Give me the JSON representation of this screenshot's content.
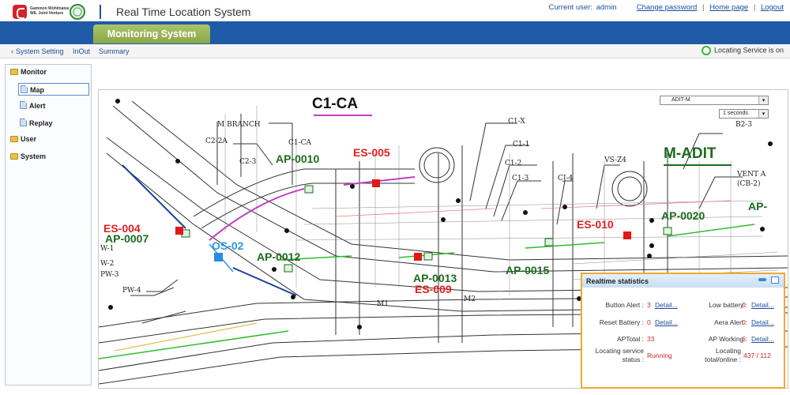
{
  "header": {
    "logo_text": "Gammon Wohlmatee WIL Joint Venture",
    "app_title": "Real Time Location System",
    "current_user_label": "Current user:",
    "current_user": "admin",
    "change_password": "Change password",
    "home_page": "Home page",
    "logout": "Logout",
    "separator": "|"
  },
  "tabs": {
    "active": "Monitoring System"
  },
  "subnav": {
    "back_icon": "chevron-left-icon",
    "items": [
      "System Setting",
      "InOut",
      "Summary"
    ],
    "status_text": "Locating Service is on",
    "status_color": "#2ebd2e"
  },
  "sidebar": {
    "items": [
      {
        "label": "Monitor",
        "icon": "folder-icon"
      },
      {
        "label": "Map",
        "icon": "document-icon",
        "selected": true
      },
      {
        "label": "Alert",
        "icon": "document-icon"
      },
      {
        "label": "Replay",
        "icon": "document-icon"
      },
      {
        "label": "User",
        "icon": "folder-icon"
      },
      {
        "label": "System",
        "icon": "folder-icon"
      }
    ]
  },
  "map": {
    "map_select": "ADIT-M",
    "interval_select": "1 seconds",
    "zone_titles": [
      "C1-CA",
      "M-ADIT"
    ],
    "labels": {
      "ap0010": "AP-0010",
      "ap0007": "AP-0007",
      "ap0012": "AP-0012",
      "ap0013": "AP-0013",
      "ap0015": "AP-0015",
      "ap0020": "AP-0020",
      "ap_partial": "AP-",
      "es005": "ES-005",
      "es004": "ES-004",
      "es009": "ES-009",
      "es010": "ES-010",
      "os02": "OS-02"
    },
    "drawing_labels": {
      "m_branch": "M BRANCH",
      "c2_2a": "C2-2A",
      "c2_3": "C2-3",
      "c1_ca": "C1-CA",
      "c1_x": "C1-X",
      "c1_1": "C1-1",
      "c1_2": "C1-2",
      "c1_3": "C1-3",
      "cj_4": "CJ-4",
      "vs_z4": "VS-Z4",
      "b2_3": "B2-3",
      "vent_a": "VENT A",
      "cb_2": "(CB-2)",
      "w_1": "W-1",
      "w_2": "W-2",
      "pw_3": "PW-3",
      "pw_4": "PW-4",
      "m1": "M1",
      "m2": "M2"
    },
    "colors": {
      "ap": "#1d6b1d",
      "es": "#e02020",
      "os": "#2a9be0",
      "marker_red": "#e01818",
      "marker_blue": "#2a8be0",
      "zone_underline_ca": "#c040c0",
      "zone_underline_madit": "#1d6b1d"
    }
  },
  "stats": {
    "title": "Realtime statistics",
    "rows": [
      {
        "label": "Button Alert :",
        "value": "3",
        "detail": "Detail..."
      },
      {
        "label": "Low battery :",
        "value": "0",
        "detail": "Detail..."
      },
      {
        "label": "Reset Battery :",
        "value": "0",
        "detail": "Detail..."
      },
      {
        "label": "Aera Alert :",
        "value": "0",
        "detail": "Detail..."
      },
      {
        "label": "APTotal :",
        "value": "33"
      },
      {
        "label": "AP Working :",
        "value": "6",
        "detail": "Detail..."
      },
      {
        "label": "Locating service status :",
        "value": "Running"
      },
      {
        "label": "Locating total/online :",
        "value": "437 / 112"
      }
    ]
  }
}
